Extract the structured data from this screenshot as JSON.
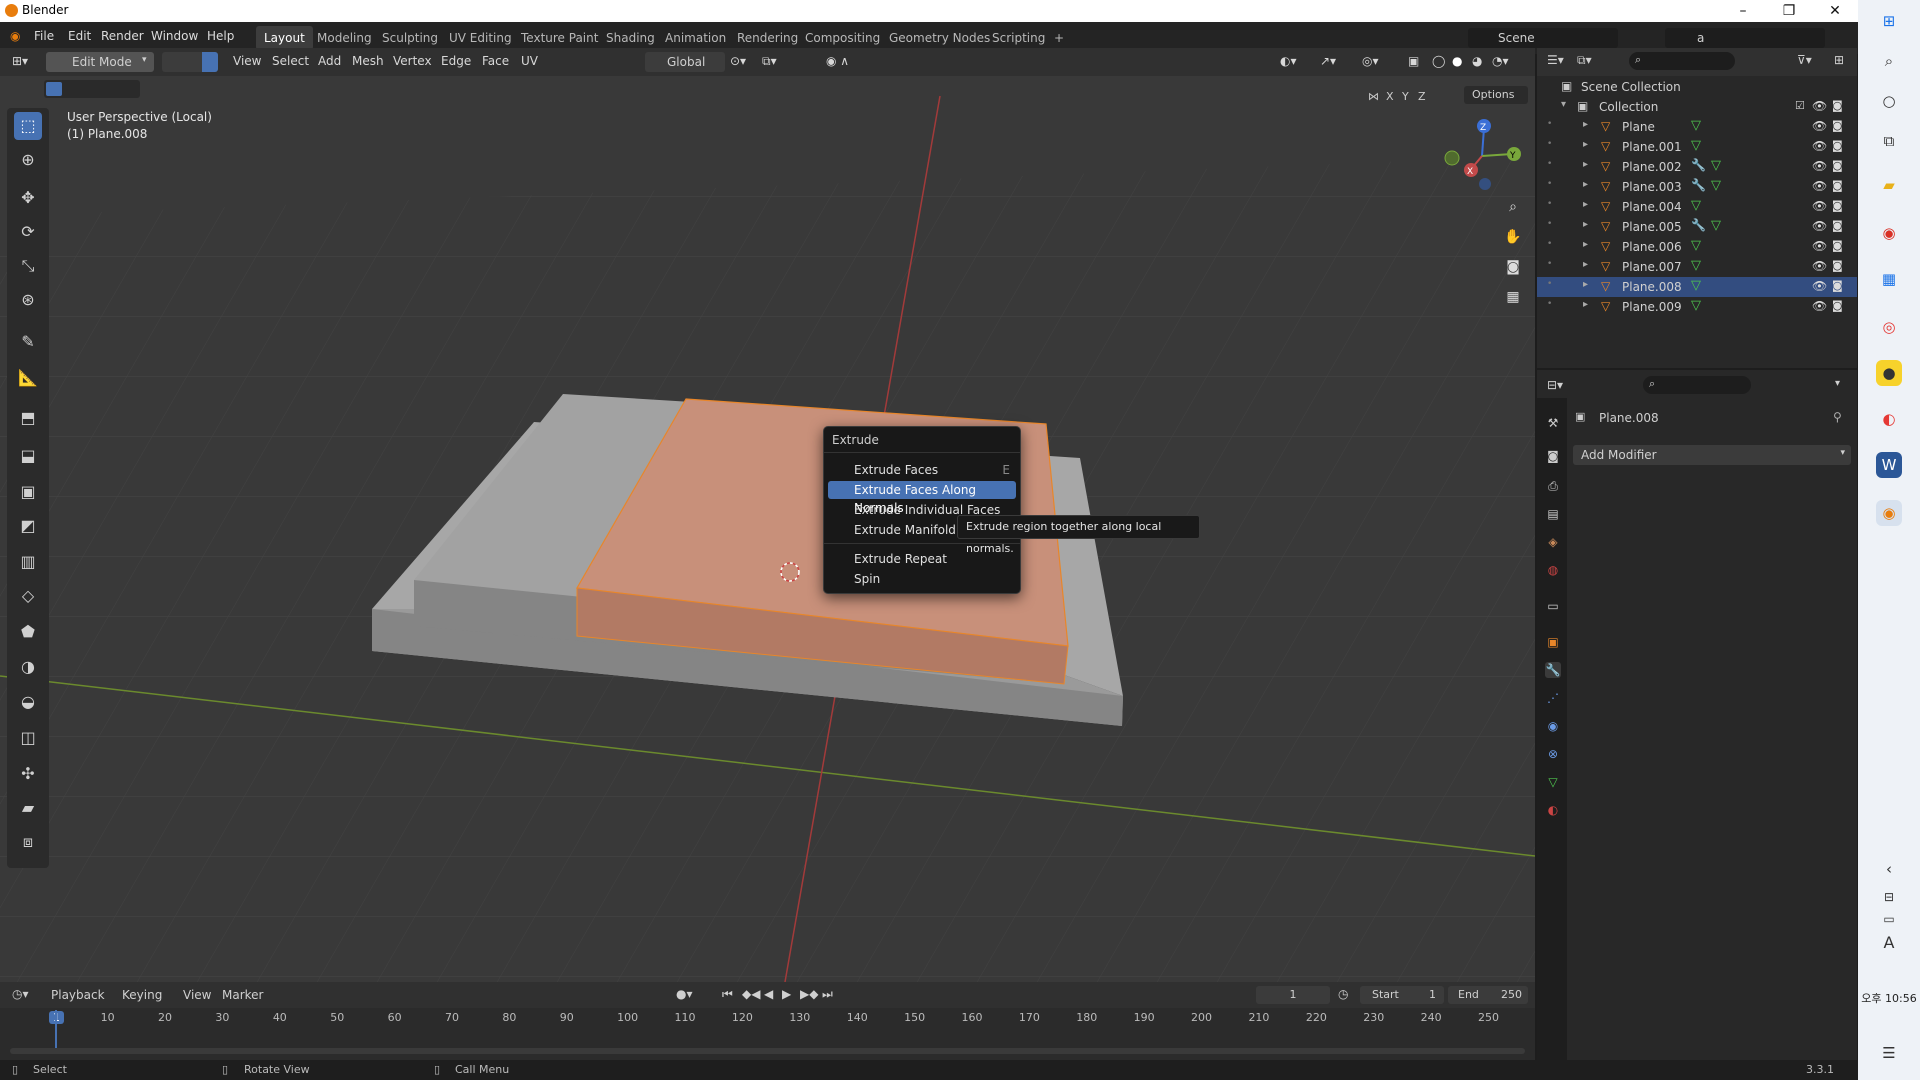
{
  "window": {
    "title": "Blender",
    "min": "–",
    "max": "❐",
    "close": "✕"
  },
  "topmenu": [
    "File",
    "Edit",
    "Render",
    "Window",
    "Help"
  ],
  "workspaces": [
    "Layout",
    "Modeling",
    "Sculpting",
    "UV Editing",
    "Texture Paint",
    "Shading",
    "Animation",
    "Rendering",
    "Compositing",
    "Geometry Nodes",
    "Scripting"
  ],
  "add_workspace": "+",
  "scene": {
    "label": "Scene",
    "viewlayer": "a"
  },
  "header": {
    "mode": "Edit Mode",
    "menus": [
      "View",
      "Select",
      "Add",
      "Mesh",
      "Vertex",
      "Edge",
      "Face",
      "UV"
    ],
    "orientation": "Global",
    "axes": [
      "X",
      "Y",
      "Z"
    ],
    "options": "Options"
  },
  "viewport": {
    "perspective": "User Perspective (Local)",
    "object": "(1) Plane.008"
  },
  "gizmo": {
    "z": "Z",
    "y": "Y",
    "x": "X"
  },
  "extrude_menu": {
    "title": "Extrude",
    "items": [
      {
        "label": "Extrude Faces",
        "shortcut": "E"
      },
      {
        "label": "Extrude Faces Along Normals",
        "shortcut": ""
      },
      {
        "label": "Extrude Individual Faces",
        "shortcut": ""
      },
      {
        "label": "Extrude Manifold",
        "shortcut": ""
      },
      {
        "label": "Extrude Repeat",
        "shortcut": ""
      },
      {
        "label": "Spin",
        "shortcut": ""
      }
    ],
    "tooltip": "Extrude region together along local normals."
  },
  "outliner": {
    "root": "Scene Collection",
    "collection": "Collection",
    "items": [
      "Plane",
      "Plane.001",
      "Plane.002",
      "Plane.003",
      "Plane.004",
      "Plane.005",
      "Plane.006",
      "Plane.007",
      "Plane.008",
      "Plane.009"
    ],
    "selected": "Plane.008"
  },
  "properties": {
    "object": "Plane.008",
    "add_modifier": "Add Modifier"
  },
  "timeline": {
    "menus": [
      "Playback",
      "Keying",
      "View",
      "Marker"
    ],
    "current_frame": "1",
    "start_label": "Start",
    "start": "1",
    "end_label": "End",
    "end": "250",
    "ticks": [
      "1",
      "10",
      "20",
      "30",
      "40",
      "50",
      "60",
      "70",
      "80",
      "90",
      "100",
      "110",
      "120",
      "130",
      "140",
      "150",
      "160",
      "170",
      "180",
      "190",
      "200",
      "210",
      "220",
      "230",
      "240",
      "250"
    ]
  },
  "status": {
    "select": "Select",
    "rotate": "Rotate View",
    "call_menu": "Call Menu",
    "version": "3.3.1"
  },
  "taskbar": {
    "time": "오후 10:56",
    "lang": "A"
  },
  "colors": {
    "accent": "#4772b3",
    "selected_face": "#c8907a",
    "orange": "#e8862a",
    "x_axis": "#c24a4a",
    "y_axis": "#7ea83b"
  }
}
